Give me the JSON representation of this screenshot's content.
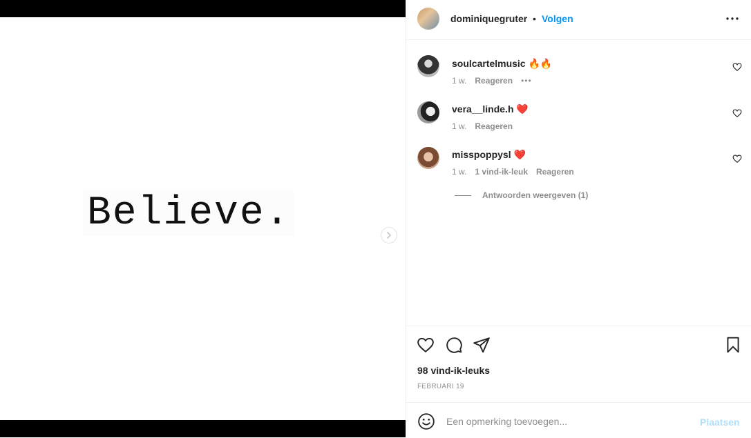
{
  "media": {
    "text": "Believe."
  },
  "header": {
    "username": "dominiquegruter",
    "separator": "•",
    "follow_label": "Volgen"
  },
  "comments": [
    {
      "username": "soulcartelmusic",
      "text": "🔥🔥",
      "time": "1 w.",
      "likes": "",
      "reply_label": "Reageren",
      "more": "•••"
    },
    {
      "username": "vera__linde.h",
      "text": "❤️",
      "time": "1 w.",
      "likes": "",
      "reply_label": "Reageren"
    },
    {
      "username": "misspoppysl",
      "text": "❤️",
      "time": "1 w.",
      "likes": "1 vind-ik-leuk",
      "reply_label": "Reageren"
    }
  ],
  "view_replies_label": "Antwoorden weergeven (1)",
  "stats": {
    "likes_label": "98 vind-ik-leuks",
    "date_label": "FEBRUARI 19"
  },
  "add_comment": {
    "placeholder": "Een opmerking toevoegen...",
    "post_label": "Plaatsen"
  },
  "colors": {
    "accent": "#0095f6",
    "post_disabled": "#b2dffc",
    "muted": "#8e8e8e",
    "text": "#262626"
  }
}
